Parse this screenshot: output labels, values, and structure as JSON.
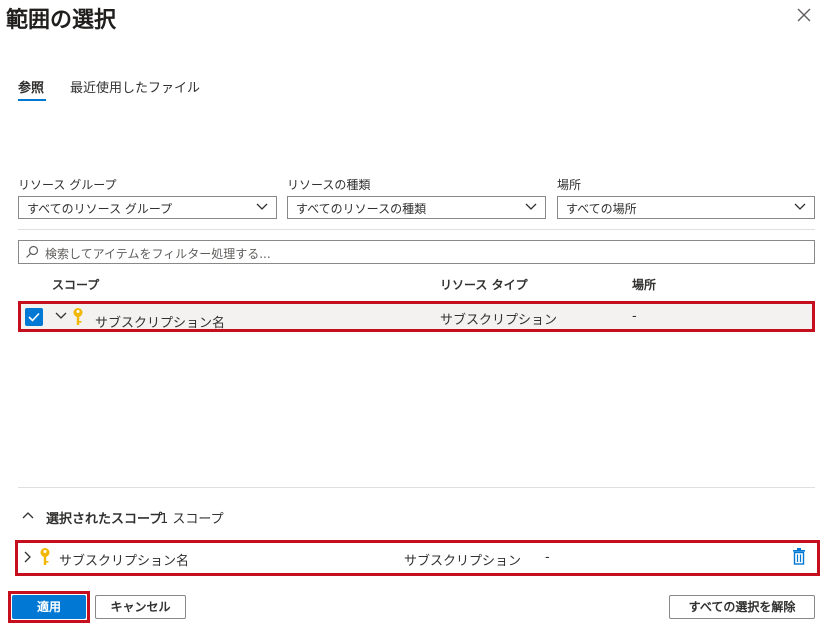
{
  "dialog": {
    "title": "範囲の選択"
  },
  "tabs": [
    {
      "label": "参照",
      "active": true
    },
    {
      "label": "最近使用したファイル",
      "active": false
    }
  ],
  "filters": [
    {
      "label": "リソース グループ",
      "value": "すべてのリソース グループ"
    },
    {
      "label": "リソースの種類",
      "value": "すべてのリソースの種類"
    },
    {
      "label": "場所",
      "value": "すべての場所"
    }
  ],
  "search": {
    "placeholder": "検索してアイテムをフィルター処理する..."
  },
  "table": {
    "columns": [
      "スコープ",
      "リソース タイプ",
      "場所"
    ],
    "rows": [
      {
        "scope": "サブスクリプション名",
        "type": "サブスクリプション",
        "location": "-",
        "checked": true
      }
    ]
  },
  "selected": {
    "title": "選択されたスコープ",
    "count": "1 スコープ",
    "rows": [
      {
        "scope": "サブスクリプション名",
        "type": "サブスクリプション",
        "location": "-"
      }
    ]
  },
  "buttons": {
    "apply": "適用",
    "cancel": "キャンセル",
    "clear": "すべての選択を解除"
  },
  "colors": {
    "accent": "#0078d4",
    "highlight": "#c50f1f",
    "key": "#f2b705",
    "trash": "#0078d4"
  }
}
